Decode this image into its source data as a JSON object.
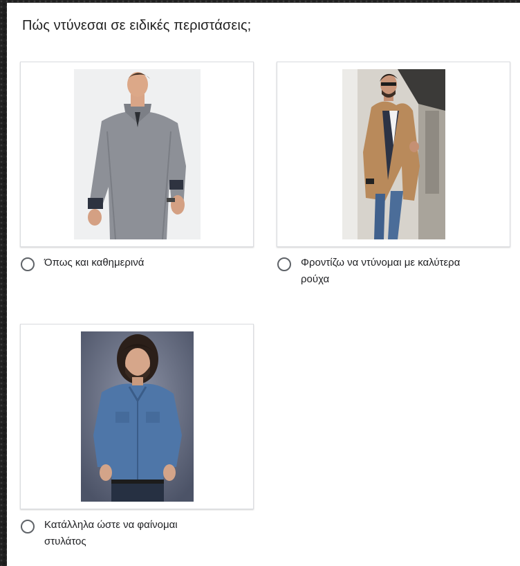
{
  "question": {
    "title": "Πώς ντύνεσαι σε ειδικές περιστάσεις;"
  },
  "options": [
    {
      "label": "Όπως και καθημερινά",
      "image": "man-grey-sweater-photo"
    },
    {
      "label": "Φροντίζω να ντύνομαι με καλύτερα ρούχα",
      "image": "man-camel-coat-photo"
    },
    {
      "label": "Κατάλληλα ώστε να φαίνομαι στυλάτος",
      "image": "man-denim-shirt-photo"
    }
  ],
  "colors": {
    "background": "#202020",
    "card": "#ffffff",
    "radio_border": "#5f6368",
    "text": "#202124"
  }
}
